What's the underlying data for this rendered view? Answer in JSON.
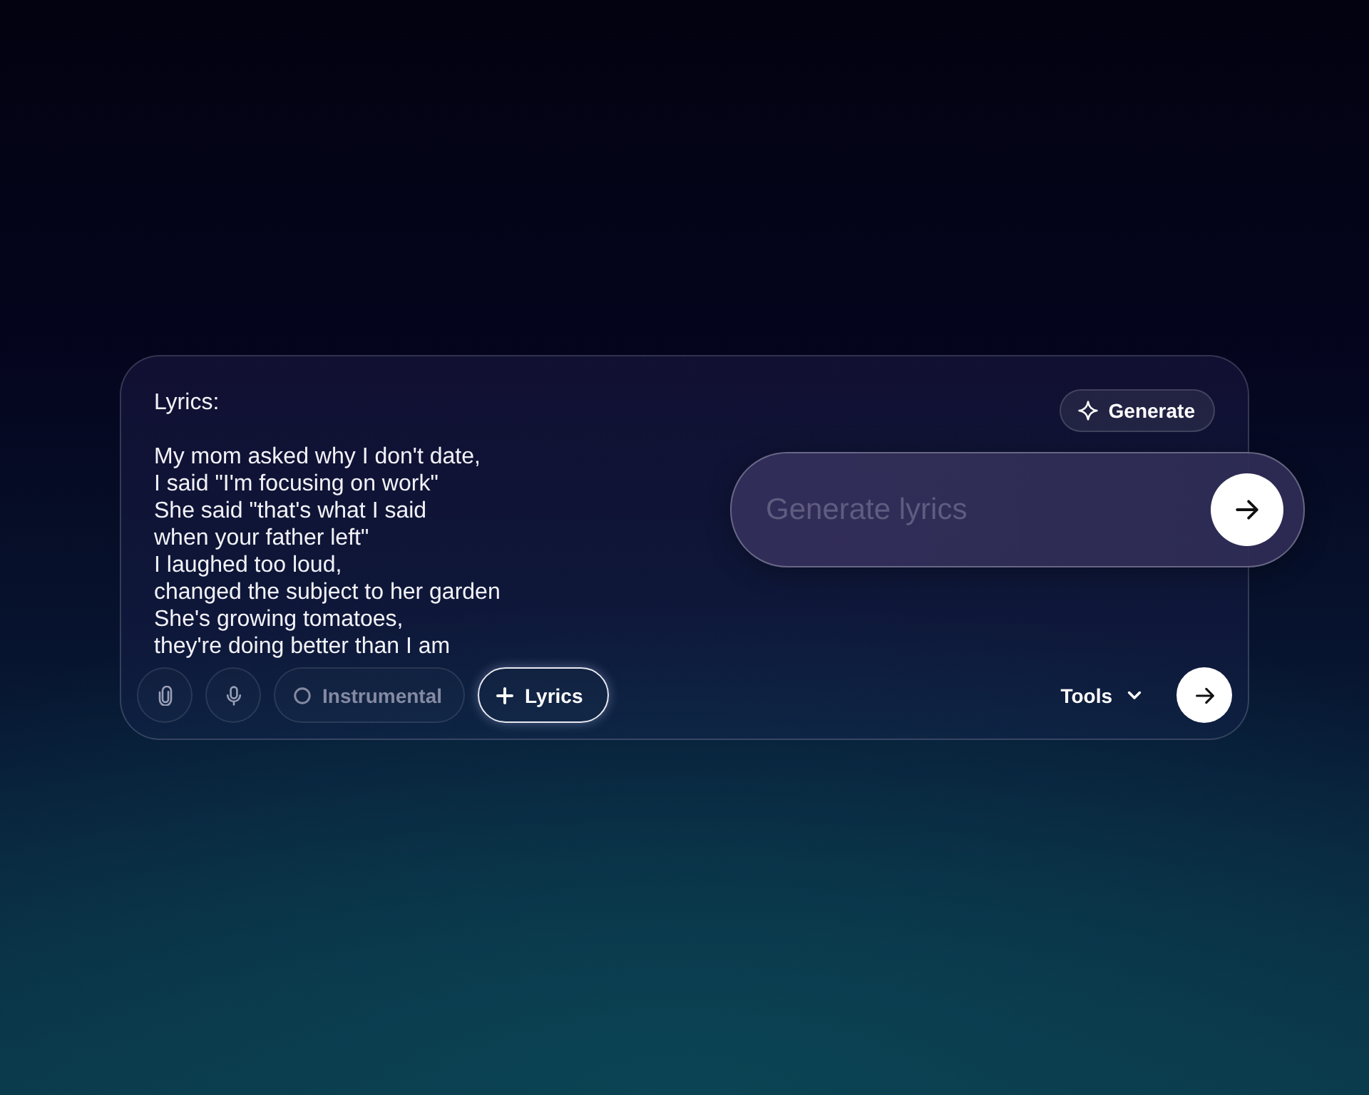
{
  "composer": {
    "lyrics_field": {
      "heading": "Lyrics:",
      "lines": [
        "My mom asked why I don't date,",
        "I said \"I'm focusing on work\"",
        "She said \"that's what I said",
        "when your father left\"",
        "I laughed too loud,",
        "changed the subject to her garden",
        "She's growing tomatoes,",
        "they're doing better than I am"
      ]
    },
    "generate_button": {
      "label": "Generate"
    },
    "lyrics_prompt": {
      "placeholder": "Generate lyrics"
    },
    "chips": [
      {
        "kind": "radio",
        "label": "Instrumental",
        "selected": false
      },
      {
        "kind": "add",
        "label": "Lyrics",
        "selected": true
      }
    ],
    "tools_menu": {
      "label": "Tools"
    }
  }
}
